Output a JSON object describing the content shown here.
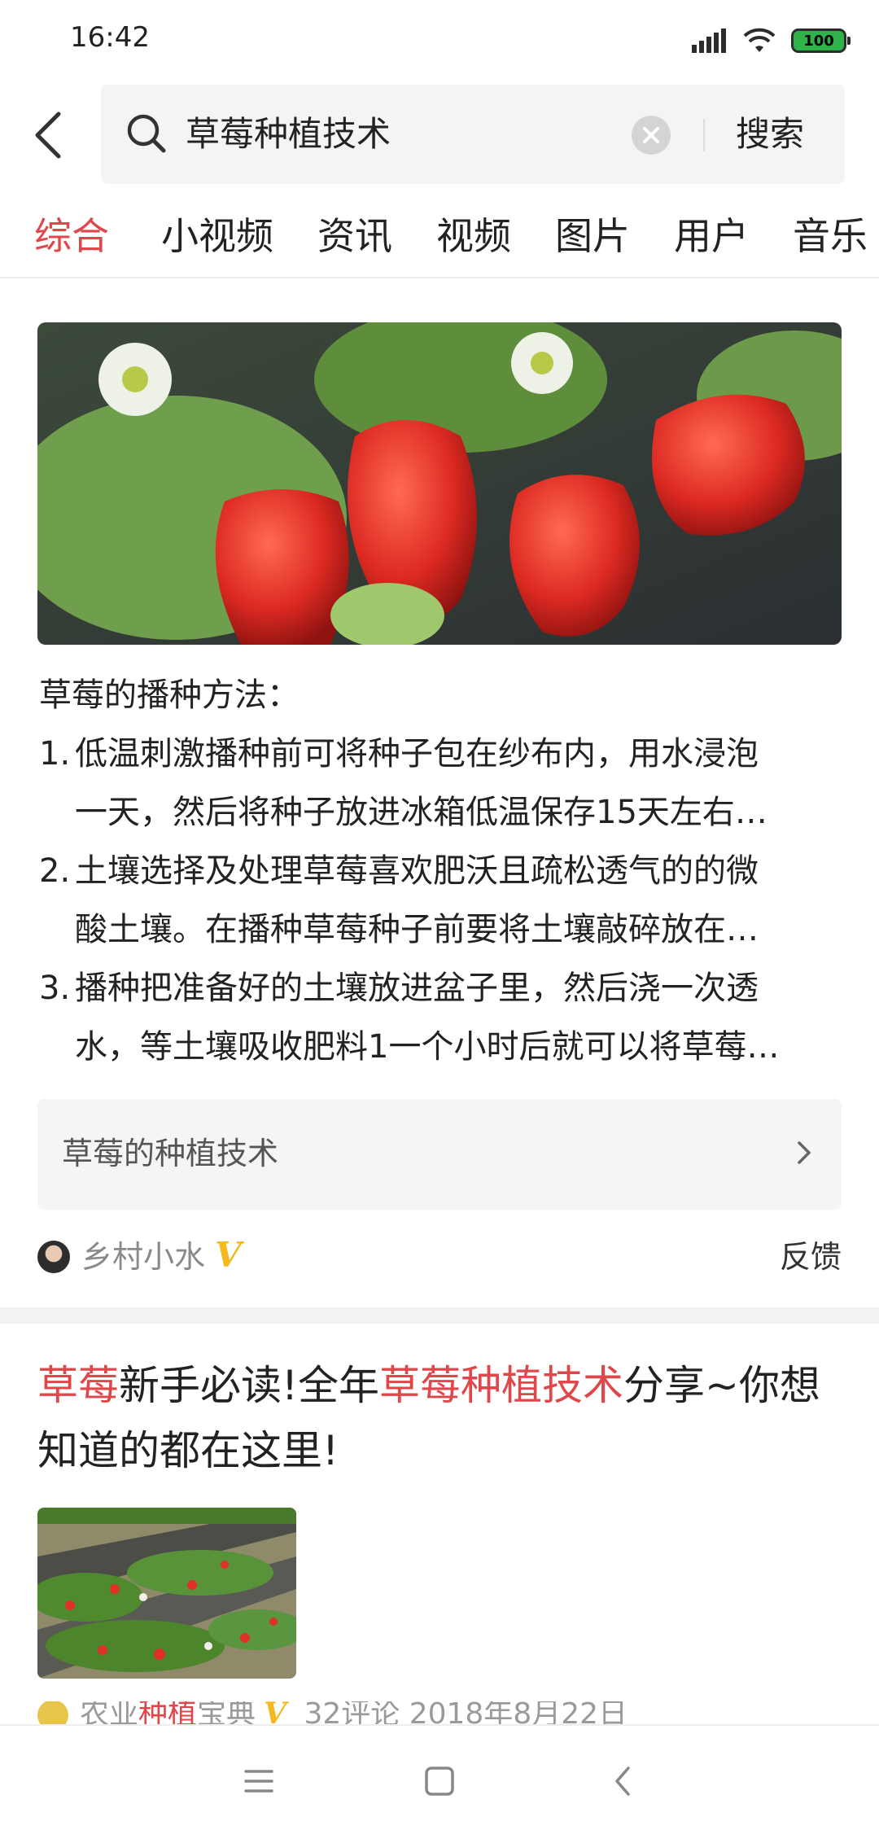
{
  "status_bar": {
    "time": "16:42",
    "battery": "100",
    "icons": [
      "signal-icon",
      "wifi-icon",
      "battery-icon"
    ]
  },
  "search": {
    "query": "草莓种植技术",
    "submit_label": "搜索",
    "icons": [
      "back-arrow-icon",
      "search-icon",
      "clear-icon"
    ]
  },
  "tabs": [
    {
      "label": "综合",
      "active": true
    },
    {
      "label": "小视频",
      "active": false
    },
    {
      "label": "资讯",
      "active": false
    },
    {
      "label": "视频",
      "active": false
    },
    {
      "label": "图片",
      "active": false
    },
    {
      "label": "用户",
      "active": false
    },
    {
      "label": "音乐",
      "active": false
    }
  ],
  "card1": {
    "image": "strawberries-photo",
    "heading": "草莓的播种方法：",
    "steps": [
      {
        "num": "1.",
        "lines": [
          "低温刺激播种前可将种子包在纱布内，用水浸泡",
          "一天，然后将种子放进冰箱低温保存15天左右…"
        ]
      },
      {
        "num": "2.",
        "lines": [
          "土壤选择及处理草莓喜欢肥沃且疏松透气的的微",
          "酸土壤。在播种草莓种子前要将土壤敲碎放在…"
        ]
      },
      {
        "num": "3.",
        "lines": [
          "播种把准备好的土壤放进盆子里，然后浇一次透",
          "水，等土壤吸收肥料1一个小时后就可以将草莓…"
        ]
      }
    ],
    "related_label": "草莓的种植技术",
    "author": "乡村小水",
    "verified_mark": "V",
    "feedback_label": "反馈"
  },
  "card2": {
    "title_parts": [
      {
        "text": "草莓",
        "highlight": true
      },
      {
        "text": "新手必读!全年",
        "highlight": false
      },
      {
        "text": "草莓种植技术",
        "highlight": true
      },
      {
        "text": "分享~你想知道的都在这里!",
        "highlight": false
      }
    ],
    "thumbnail": "strawberry-field-photo",
    "meta": {
      "author_prefix": "农业",
      "author_highlight": "种植",
      "author_suffix": "宝典",
      "verified_mark": "V",
      "comments": "32评论",
      "date": "2018年8月22日"
    }
  },
  "colors": {
    "accent_red": "#e0474b",
    "verified_gold": "#f3b91f",
    "battery_green": "#2fb24a"
  },
  "nav": {
    "icons": [
      "menu-icon",
      "home-icon",
      "back-icon"
    ]
  }
}
